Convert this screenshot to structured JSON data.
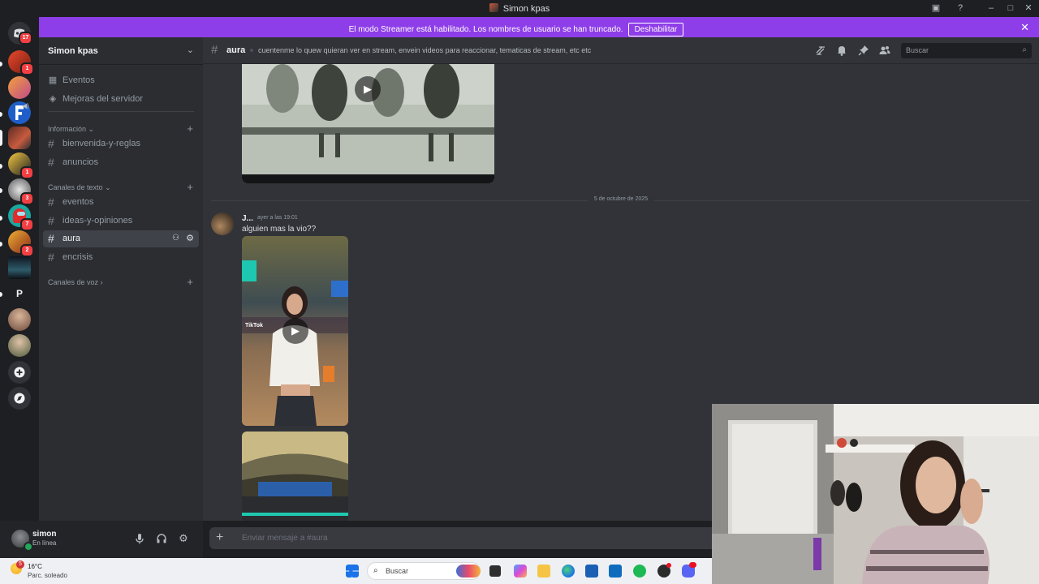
{
  "window": {
    "title": "Simon kpas"
  },
  "banner": {
    "message": "El modo Streamer está habilitado. Los nombres de usuario se han truncado.",
    "button_label": "Deshabilitar"
  },
  "rail": {
    "dm_badge": "17",
    "server_badges": [
      "1",
      "1",
      "3",
      "7",
      "2"
    ],
    "letter_server": "P"
  },
  "sidebar": {
    "server_name": "Simon kpas",
    "nav": [
      {
        "label": "Eventos",
        "icon": "calendar-icon"
      },
      {
        "label": "Mejoras del servidor",
        "icon": "boost-icon"
      }
    ],
    "categories": [
      {
        "label": "Información",
        "channels": [
          "bienvenida-y-reglas",
          "anuncios"
        ]
      },
      {
        "label": "Canales de texto",
        "channels": [
          "eventos",
          "ideas-y-opiniones",
          "aura",
          "encrisis"
        ]
      },
      {
        "label": "Canales de voz",
        "channels": []
      }
    ],
    "active_channel": "aura"
  },
  "user": {
    "name": "simon",
    "status": "En línea"
  },
  "header": {
    "channel": "aura",
    "topic": "cuentenme lo quew quieran ver en stream, envein videos para reaccionar, tematicas de stream, etc etc",
    "search_placeholder": "Buscar"
  },
  "chat": {
    "date_divider": "5 de octubre de 2025",
    "message": {
      "author": "J...",
      "timestamp": "ayer a las 19:01",
      "text": "alguien mas la vio??",
      "embed_watermark": "TikTok"
    }
  },
  "composer": {
    "placeholder": "Enviar mensaje a #aura"
  },
  "taskbar": {
    "weather_badge": "5",
    "temperature": "16°C",
    "condition": "Parc. soleado",
    "search_label": "Buscar"
  },
  "colors": {
    "streamer_banner": "#8e3ee8",
    "online": "#23a55a",
    "badge": "#f23f43"
  }
}
